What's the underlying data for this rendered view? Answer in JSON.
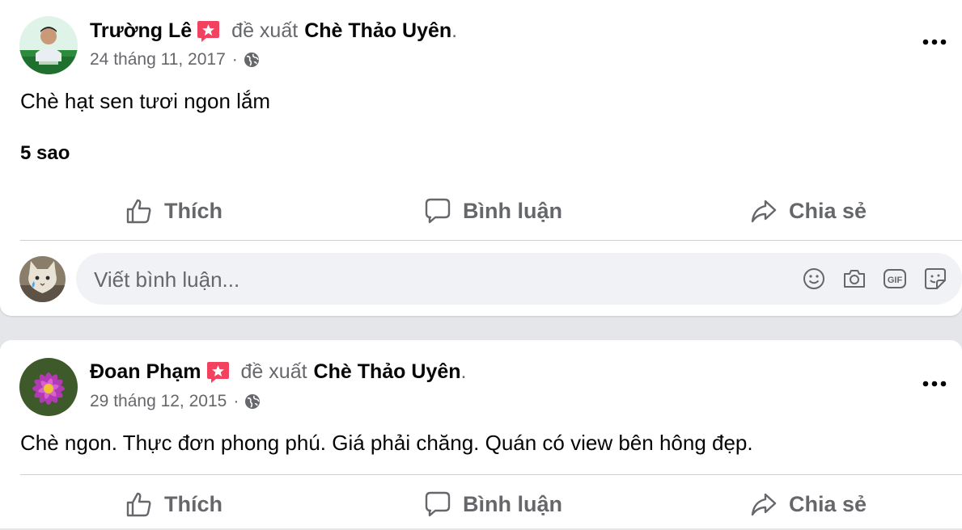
{
  "posts": [
    {
      "author": "Trường Lê",
      "action_text": "đề xuất",
      "page_name": "Chè Thảo Uyên",
      "date": "24 tháng 11, 2017",
      "body": "Chè hạt sen tươi ngon lắm",
      "rating_text": "5 sao"
    },
    {
      "author": "Đoan Phạm",
      "action_text": "đề xuất",
      "page_name": "Chè Thảo Uyên",
      "date": "29 tháng 12, 2015",
      "body": "Chè ngon. Thực đơn phong phú. Giá phải chăng. Quán có view bên hông đẹp."
    }
  ],
  "actions": {
    "like": "Thích",
    "comment": "Bình luận",
    "share": "Chia sẻ"
  },
  "comment_box": {
    "placeholder": "Viết bình luận..."
  },
  "icons": {
    "recommend_badge": "recommend-star-icon",
    "privacy": "globe-icon",
    "more": "more-options-icon",
    "like": "thumbs-up-icon",
    "comment": "speech-bubble-icon",
    "share": "share-arrow-icon",
    "emoji": "emoji-icon",
    "camera": "camera-icon",
    "gif": "gif-icon",
    "sticker": "sticker-icon"
  },
  "colors": {
    "badge": "#f3425f",
    "text": "#050505",
    "secondary": "#65676b",
    "comment_bg": "#f0f2f5"
  },
  "sep": {
    "dot": "·",
    "period": "."
  }
}
